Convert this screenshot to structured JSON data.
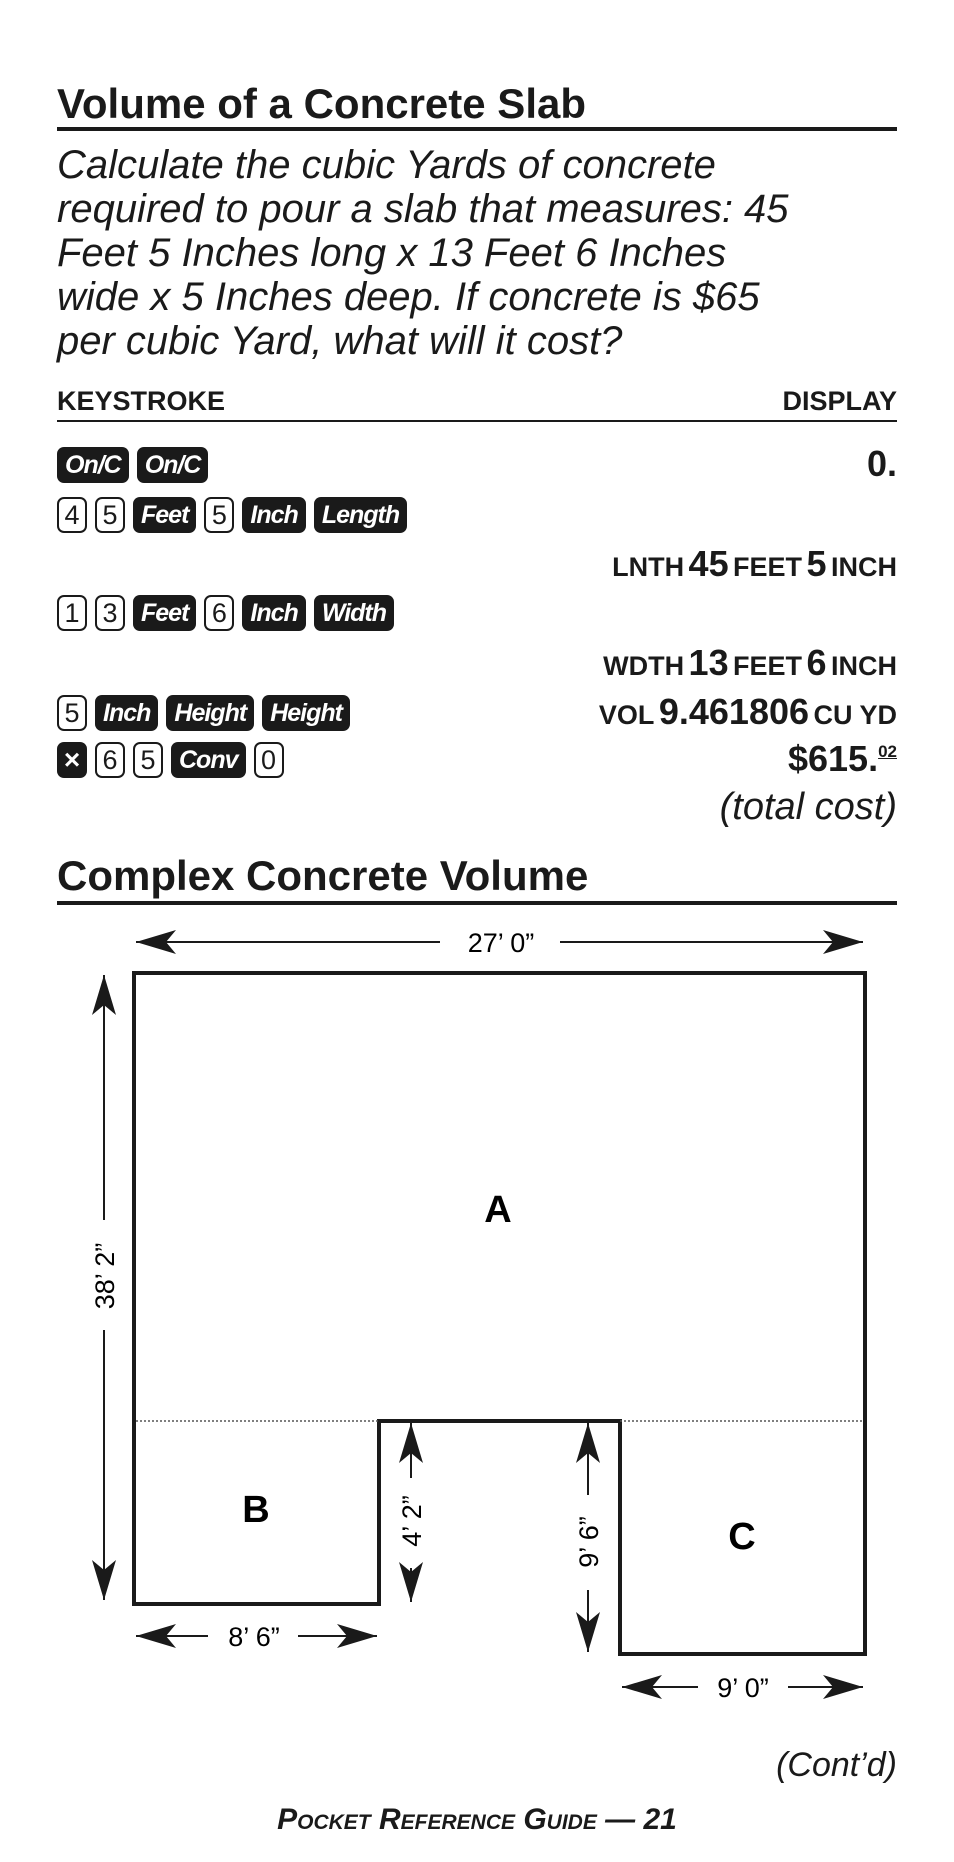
{
  "section1": {
    "title": "Volume of a Concrete Slab",
    "problem_lines": [
      "Calculate the cubic Yards of concrete",
      "required to pour a slab that measures: 45",
      "Feet 5 Inches long x 13 Feet 6 Inches",
      "wide x 5 Inches deep. If concrete is $65",
      "per cubic Yard, what will it cost?"
    ],
    "col_keystroke": "KEYSTROKE",
    "col_display": "DISPLAY",
    "rows": [
      {
        "keys": [
          "On/C",
          "On/C"
        ],
        "display": "0."
      },
      {
        "keys": [
          "4",
          "5",
          "Feet",
          "5",
          "Inch",
          "Length"
        ]
      },
      {
        "display_parts": [
          "LNTH",
          "45",
          "FEET",
          "5",
          "INCH"
        ]
      },
      {
        "keys": [
          "1",
          "3",
          "Feet",
          "6",
          "Inch",
          "Width"
        ]
      },
      {
        "display_parts": [
          "WDTH",
          "13",
          "FEET",
          "6",
          "INCH"
        ]
      },
      {
        "keys": [
          "5",
          "Inch",
          "Height",
          "Height"
        ],
        "display_parts": [
          "VOL",
          "9.461806",
          "CU YD"
        ]
      },
      {
        "keys": [
          "×",
          "6",
          "5",
          "Conv",
          "0"
        ],
        "display_main": "$615.",
        "display_sup": "02"
      },
      {
        "note": "(total cost)"
      }
    ]
  },
  "section2": {
    "title": "Complex Concrete Volume",
    "diagram": {
      "top_width": "27’ 0”",
      "left_height": "38’ 2”",
      "notch_depth": "4’ 2”",
      "c_height": "9’ 6”",
      "b_width": "8’ 6”",
      "c_width": "9’ 0”",
      "label_a": "A",
      "label_b": "B",
      "label_c": "C"
    }
  },
  "footer": {
    "contd": "(Cont’d)",
    "guide": "Pocket Reference Guide — 21"
  }
}
